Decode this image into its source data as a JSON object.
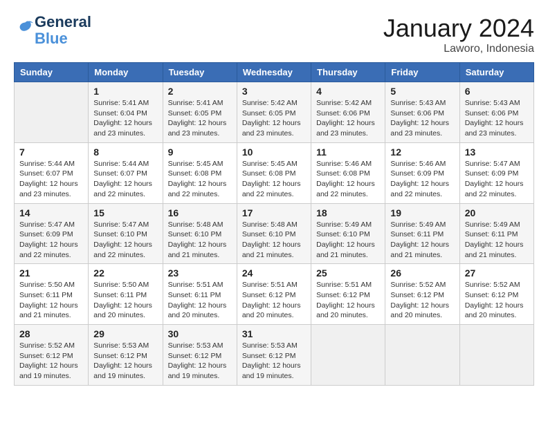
{
  "logo": {
    "line1": "General",
    "line2": "Blue"
  },
  "title": "January 2024",
  "subtitle": "Laworo, Indonesia",
  "days_header": [
    "Sunday",
    "Monday",
    "Tuesday",
    "Wednesday",
    "Thursday",
    "Friday",
    "Saturday"
  ],
  "weeks": [
    [
      {
        "day": "",
        "sunrise": "",
        "sunset": "",
        "daylight": ""
      },
      {
        "day": "1",
        "sunrise": "Sunrise: 5:41 AM",
        "sunset": "Sunset: 6:04 PM",
        "daylight": "Daylight: 12 hours and 23 minutes."
      },
      {
        "day": "2",
        "sunrise": "Sunrise: 5:41 AM",
        "sunset": "Sunset: 6:05 PM",
        "daylight": "Daylight: 12 hours and 23 minutes."
      },
      {
        "day": "3",
        "sunrise": "Sunrise: 5:42 AM",
        "sunset": "Sunset: 6:05 PM",
        "daylight": "Daylight: 12 hours and 23 minutes."
      },
      {
        "day": "4",
        "sunrise": "Sunrise: 5:42 AM",
        "sunset": "Sunset: 6:06 PM",
        "daylight": "Daylight: 12 hours and 23 minutes."
      },
      {
        "day": "5",
        "sunrise": "Sunrise: 5:43 AM",
        "sunset": "Sunset: 6:06 PM",
        "daylight": "Daylight: 12 hours and 23 minutes."
      },
      {
        "day": "6",
        "sunrise": "Sunrise: 5:43 AM",
        "sunset": "Sunset: 6:06 PM",
        "daylight": "Daylight: 12 hours and 23 minutes."
      }
    ],
    [
      {
        "day": "7",
        "sunrise": "Sunrise: 5:44 AM",
        "sunset": "Sunset: 6:07 PM",
        "daylight": "Daylight: 12 hours and 23 minutes."
      },
      {
        "day": "8",
        "sunrise": "Sunrise: 5:44 AM",
        "sunset": "Sunset: 6:07 PM",
        "daylight": "Daylight: 12 hours and 22 minutes."
      },
      {
        "day": "9",
        "sunrise": "Sunrise: 5:45 AM",
        "sunset": "Sunset: 6:08 PM",
        "daylight": "Daylight: 12 hours and 22 minutes."
      },
      {
        "day": "10",
        "sunrise": "Sunrise: 5:45 AM",
        "sunset": "Sunset: 6:08 PM",
        "daylight": "Daylight: 12 hours and 22 minutes."
      },
      {
        "day": "11",
        "sunrise": "Sunrise: 5:46 AM",
        "sunset": "Sunset: 6:08 PM",
        "daylight": "Daylight: 12 hours and 22 minutes."
      },
      {
        "day": "12",
        "sunrise": "Sunrise: 5:46 AM",
        "sunset": "Sunset: 6:09 PM",
        "daylight": "Daylight: 12 hours and 22 minutes."
      },
      {
        "day": "13",
        "sunrise": "Sunrise: 5:47 AM",
        "sunset": "Sunset: 6:09 PM",
        "daylight": "Daylight: 12 hours and 22 minutes."
      }
    ],
    [
      {
        "day": "14",
        "sunrise": "Sunrise: 5:47 AM",
        "sunset": "Sunset: 6:09 PM",
        "daylight": "Daylight: 12 hours and 22 minutes."
      },
      {
        "day": "15",
        "sunrise": "Sunrise: 5:47 AM",
        "sunset": "Sunset: 6:10 PM",
        "daylight": "Daylight: 12 hours and 22 minutes."
      },
      {
        "day": "16",
        "sunrise": "Sunrise: 5:48 AM",
        "sunset": "Sunset: 6:10 PM",
        "daylight": "Daylight: 12 hours and 21 minutes."
      },
      {
        "day": "17",
        "sunrise": "Sunrise: 5:48 AM",
        "sunset": "Sunset: 6:10 PM",
        "daylight": "Daylight: 12 hours and 21 minutes."
      },
      {
        "day": "18",
        "sunrise": "Sunrise: 5:49 AM",
        "sunset": "Sunset: 6:10 PM",
        "daylight": "Daylight: 12 hours and 21 minutes."
      },
      {
        "day": "19",
        "sunrise": "Sunrise: 5:49 AM",
        "sunset": "Sunset: 6:11 PM",
        "daylight": "Daylight: 12 hours and 21 minutes."
      },
      {
        "day": "20",
        "sunrise": "Sunrise: 5:49 AM",
        "sunset": "Sunset: 6:11 PM",
        "daylight": "Daylight: 12 hours and 21 minutes."
      }
    ],
    [
      {
        "day": "21",
        "sunrise": "Sunrise: 5:50 AM",
        "sunset": "Sunset: 6:11 PM",
        "daylight": "Daylight: 12 hours and 21 minutes."
      },
      {
        "day": "22",
        "sunrise": "Sunrise: 5:50 AM",
        "sunset": "Sunset: 6:11 PM",
        "daylight": "Daylight: 12 hours and 20 minutes."
      },
      {
        "day": "23",
        "sunrise": "Sunrise: 5:51 AM",
        "sunset": "Sunset: 6:11 PM",
        "daylight": "Daylight: 12 hours and 20 minutes."
      },
      {
        "day": "24",
        "sunrise": "Sunrise: 5:51 AM",
        "sunset": "Sunset: 6:12 PM",
        "daylight": "Daylight: 12 hours and 20 minutes."
      },
      {
        "day": "25",
        "sunrise": "Sunrise: 5:51 AM",
        "sunset": "Sunset: 6:12 PM",
        "daylight": "Daylight: 12 hours and 20 minutes."
      },
      {
        "day": "26",
        "sunrise": "Sunrise: 5:52 AM",
        "sunset": "Sunset: 6:12 PM",
        "daylight": "Daylight: 12 hours and 20 minutes."
      },
      {
        "day": "27",
        "sunrise": "Sunrise: 5:52 AM",
        "sunset": "Sunset: 6:12 PM",
        "daylight": "Daylight: 12 hours and 20 minutes."
      }
    ],
    [
      {
        "day": "28",
        "sunrise": "Sunrise: 5:52 AM",
        "sunset": "Sunset: 6:12 PM",
        "daylight": "Daylight: 12 hours and 19 minutes."
      },
      {
        "day": "29",
        "sunrise": "Sunrise: 5:53 AM",
        "sunset": "Sunset: 6:12 PM",
        "daylight": "Daylight: 12 hours and 19 minutes."
      },
      {
        "day": "30",
        "sunrise": "Sunrise: 5:53 AM",
        "sunset": "Sunset: 6:12 PM",
        "daylight": "Daylight: 12 hours and 19 minutes."
      },
      {
        "day": "31",
        "sunrise": "Sunrise: 5:53 AM",
        "sunset": "Sunset: 6:12 PM",
        "daylight": "Daylight: 12 hours and 19 minutes."
      },
      {
        "day": "",
        "sunrise": "",
        "sunset": "",
        "daylight": ""
      },
      {
        "day": "",
        "sunrise": "",
        "sunset": "",
        "daylight": ""
      },
      {
        "day": "",
        "sunrise": "",
        "sunset": "",
        "daylight": ""
      }
    ]
  ]
}
